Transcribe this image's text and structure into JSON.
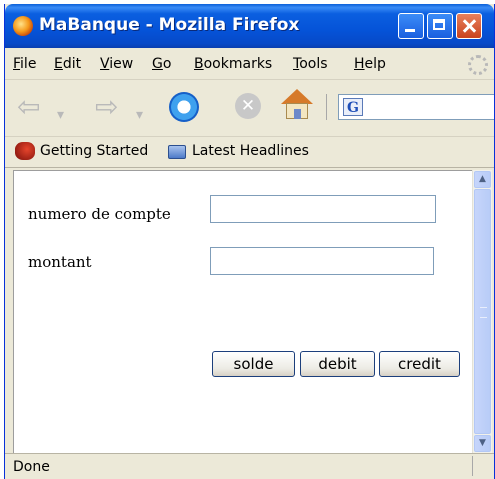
{
  "window": {
    "title": "MaBanque - Mozilla Firefox"
  },
  "menu": [
    {
      "label": "File",
      "accel": "F",
      "rest": "ile"
    },
    {
      "label": "Edit",
      "accel": "E",
      "rest": "dit"
    },
    {
      "label": "View",
      "accel": "V",
      "rest": "iew"
    },
    {
      "label": "Go",
      "accel": "G",
      "rest": "o"
    },
    {
      "label": "Bookmarks",
      "accel": "B",
      "rest": "ookmarks"
    },
    {
      "label": "Tools",
      "accel": "T",
      "rest": "ools"
    },
    {
      "label": "Help",
      "accel": "H",
      "rest": "elp"
    }
  ],
  "toolbar": {
    "back_icon": "back-arrow-icon",
    "forward_icon": "forward-arrow-icon",
    "reload_icon": "reload-icon",
    "stop_icon": "stop-icon",
    "home_icon": "home-icon",
    "search_engine_letter": "G"
  },
  "bookmarks": [
    {
      "label": "Getting Started",
      "icon": "firefox-icon"
    },
    {
      "label": "Latest Headlines",
      "icon": "folder-icon"
    }
  ],
  "form": {
    "account_label": "numero de compte",
    "account_value": "",
    "amount_label": "montant",
    "amount_value": "",
    "buttons": {
      "solde": "solde",
      "debit": "debit",
      "credit": "credit"
    }
  },
  "status": {
    "text": "Done"
  },
  "colors": {
    "titlebar": "#0553d8",
    "chrome": "#ece9d8",
    "scrollbar": "#c6d5fb"
  }
}
